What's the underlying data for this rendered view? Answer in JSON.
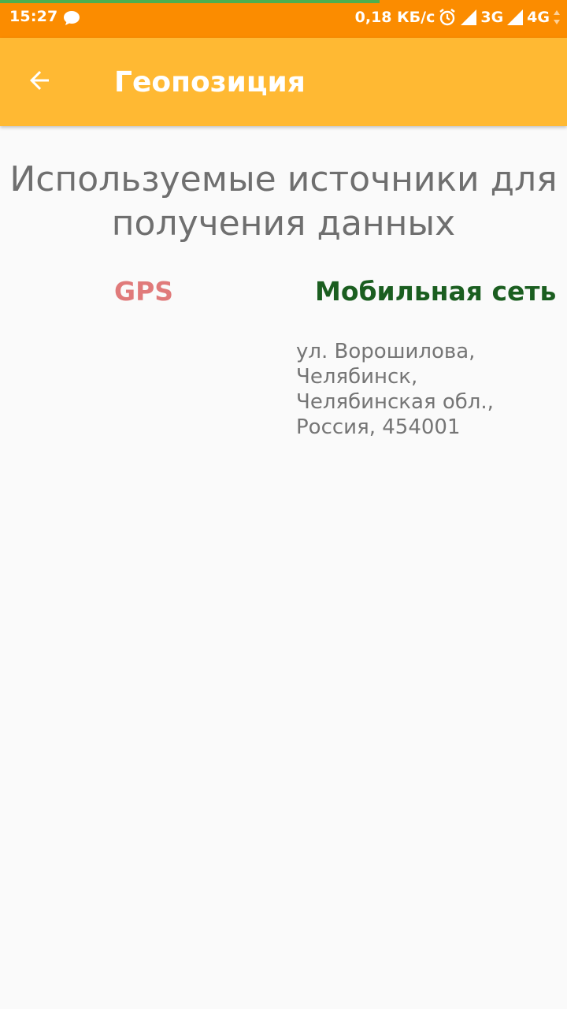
{
  "status_bar": {
    "time": "15:27",
    "net_speed": "0,18 КБ/с",
    "network_1": "3G",
    "network_2": "4G",
    "bg_color": "#fb8c00",
    "progress": 0.67
  },
  "app_bar": {
    "title": "Геопозиция",
    "bg_color": "#ffb933"
  },
  "content": {
    "heading": "Используемые источники для получения данных",
    "sources": {
      "gps": {
        "label": "GPS",
        "color": "#e07a7a"
      },
      "mobile_network": {
        "label": "Мобильная сеть",
        "color": "#1b5e20",
        "address": "ул. Ворошилова, Челябинск, Челябинская обл., Россия, 454001"
      }
    }
  },
  "icons": {
    "back": "arrow-left-icon",
    "chat": "chat-bubble-icon",
    "alarm": "alarm-clock-icon",
    "signal": "signal-icon"
  }
}
